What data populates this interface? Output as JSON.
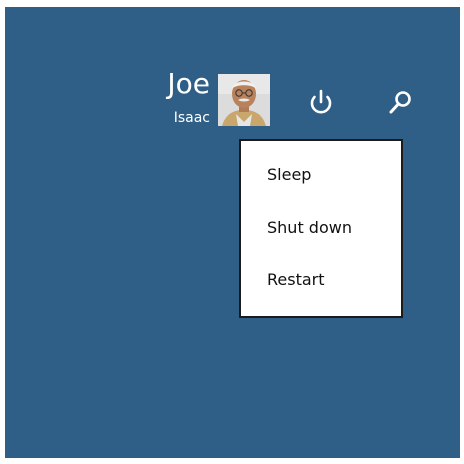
{
  "user": {
    "first_name": "Joe",
    "last_name": "Isaac"
  },
  "header": {
    "avatar_icon": "user-photo",
    "power_icon": "power-icon",
    "search_icon": "search-icon"
  },
  "power_menu": {
    "items": [
      {
        "label": "Sleep"
      },
      {
        "label": "Shut down"
      },
      {
        "label": "Restart"
      }
    ]
  },
  "colors": {
    "background": "#2f5f86",
    "menu_background": "#ffffff",
    "menu_border": "#1b1b1b",
    "text_light": "#ffffff",
    "text_dark": "#111111"
  }
}
